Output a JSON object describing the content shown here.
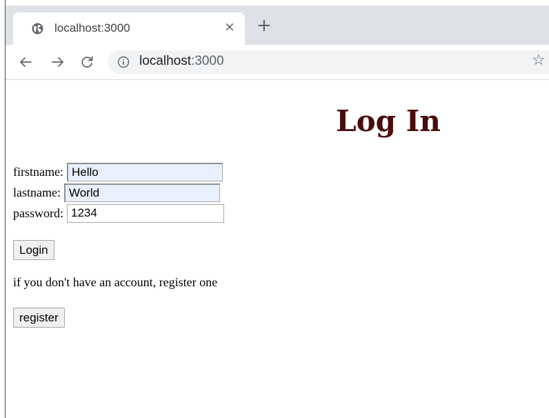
{
  "browser": {
    "tab_title": "localhost:3000",
    "tab_close": "×",
    "new_tab": "+",
    "url_host": "localhost",
    "url_port": ":3000",
    "star": "☆"
  },
  "page": {
    "title": "Log In",
    "form": {
      "firstname_label": "firstname:",
      "firstname_value": "Hello",
      "lastname_label": "lastname:",
      "lastname_value": "World",
      "password_label": "password:",
      "password_value": "1234",
      "login_label": "Login"
    },
    "register_message": "if you don't have an account, register one",
    "register_label": "register"
  },
  "colors": {
    "title": "#4a0c0c",
    "autofill_bg": "#e8f0fe",
    "tabstrip_bg": "#dee1e6"
  }
}
